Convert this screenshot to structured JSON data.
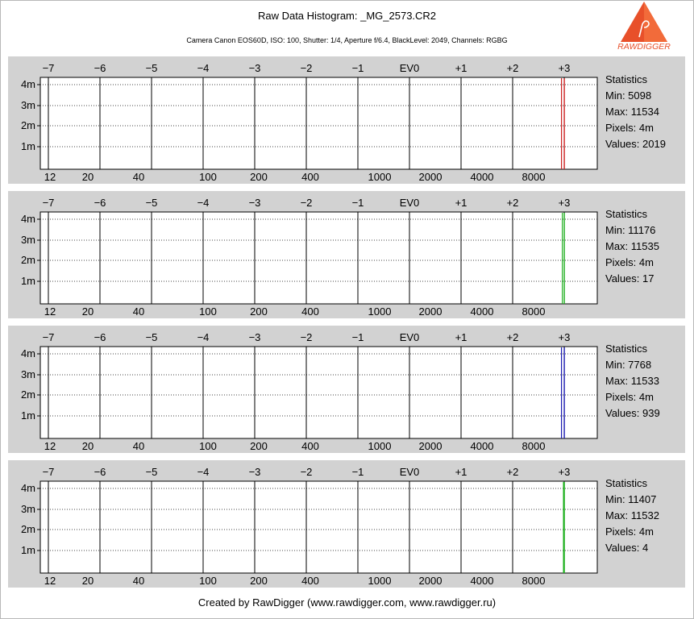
{
  "header": {
    "title": "Raw Data Histogram: _MG_2573.CR2",
    "subtitle": "Camera Canon EOS60D, ISO: 100, Shutter: 1/4, Aperture f/6.4, BlackLevel: 2049, Channels: RGBG"
  },
  "logo": {
    "text": "RAWDIGGER",
    "icon": "rawdigger-logo-icon",
    "color": "#e8502a"
  },
  "footer": {
    "text": "Created by RawDigger (www.rawdigger.com, www.rawdigger.ru)"
  },
  "chart_data": [
    {
      "type": "histogram",
      "channel_color": "#cc2020",
      "ev_ticks": [
        "−7",
        "−6",
        "−5",
        "−4",
        "−3",
        "−2",
        "−1",
        "EV0",
        "+1",
        "+2",
        "+3"
      ],
      "x_ticks": [
        "12",
        "20",
        "40",
        "100",
        "200",
        "400",
        "1000",
        "2000",
        "4000",
        "8000"
      ],
      "y_ticks": [
        "4m",
        "3m",
        "2m",
        "1m"
      ],
      "x_scale": "log",
      "bin_range": [
        5098,
        11534
      ],
      "stats": {
        "heading": "Statistics",
        "min": "Min: 5098",
        "max": "Max: 11534",
        "pixels": "Pixels: 4m",
        "values": "Values: 2019"
      }
    },
    {
      "type": "histogram",
      "channel_color": "#20b020",
      "ev_ticks": [
        "−7",
        "−6",
        "−5",
        "−4",
        "−3",
        "−2",
        "−1",
        "EV0",
        "+1",
        "+2",
        "+3"
      ],
      "x_ticks": [
        "12",
        "20",
        "40",
        "100",
        "200",
        "400",
        "1000",
        "2000",
        "4000",
        "8000"
      ],
      "y_ticks": [
        "4m",
        "3m",
        "2m",
        "1m"
      ],
      "x_scale": "log",
      "bin_range": [
        11176,
        11535
      ],
      "stats": {
        "heading": "Statistics",
        "min": "Min: 11176",
        "max": "Max: 11535",
        "pixels": "Pixels: 4m",
        "values": "Values: 17"
      }
    },
    {
      "type": "histogram",
      "channel_color": "#1a1ab0",
      "ev_ticks": [
        "−7",
        "−6",
        "−5",
        "−4",
        "−3",
        "−2",
        "−1",
        "EV0",
        "+1",
        "+2",
        "+3"
      ],
      "x_ticks": [
        "12",
        "20",
        "40",
        "100",
        "200",
        "400",
        "1000",
        "2000",
        "4000",
        "8000"
      ],
      "y_ticks": [
        "4m",
        "3m",
        "2m",
        "1m"
      ],
      "x_scale": "log",
      "bin_range": [
        7768,
        11533
      ],
      "stats": {
        "heading": "Statistics",
        "min": "Min: 7768",
        "max": "Max: 11533",
        "pixels": "Pixels: 4m",
        "values": "Values: 939"
      }
    },
    {
      "type": "histogram",
      "channel_color": "#20b020",
      "ev_ticks": [
        "−7",
        "−6",
        "−5",
        "−4",
        "−3",
        "−2",
        "−1",
        "EV0",
        "+1",
        "+2",
        "+3"
      ],
      "x_ticks": [
        "12",
        "20",
        "40",
        "100",
        "200",
        "400",
        "1000",
        "2000",
        "4000",
        "8000"
      ],
      "y_ticks": [
        "4m",
        "3m",
        "2m",
        "1m"
      ],
      "x_scale": "log",
      "bin_range": [
        11407,
        11532
      ],
      "stats": {
        "heading": "Statistics",
        "min": "Min: 11407",
        "max": "Max: 11532",
        "pixels": "Pixels: 4m",
        "values": "Values: 4"
      }
    }
  ]
}
